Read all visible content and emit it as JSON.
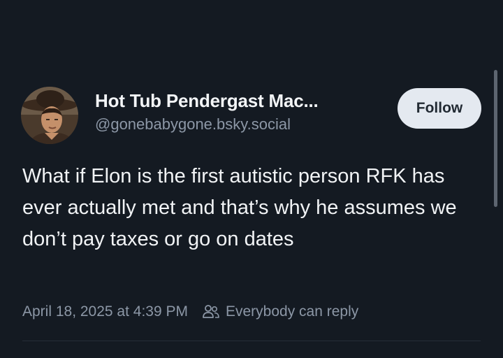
{
  "post": {
    "author": {
      "display_name": "Hot Tub Pendergast Mac...",
      "handle": "@gonebabygone.bsky.social",
      "avatar_icon": "person-in-cowboy-hat-avatar"
    },
    "follow_label": "Follow",
    "text": "What if Elon is the first autistic person RFK has ever actually met and that’s why he assumes we don’t pay taxes or go on dates",
    "timestamp": "April 18, 2025 at 4:39 PM",
    "reply_setting": {
      "icon": "people-icon",
      "label": "Everybody can reply"
    }
  },
  "colors": {
    "background": "#141a22",
    "primary_text": "#f1f3f5",
    "secondary_text": "#8c97a6",
    "follow_button_bg": "#e4e9f0",
    "follow_button_text": "#222a33"
  }
}
